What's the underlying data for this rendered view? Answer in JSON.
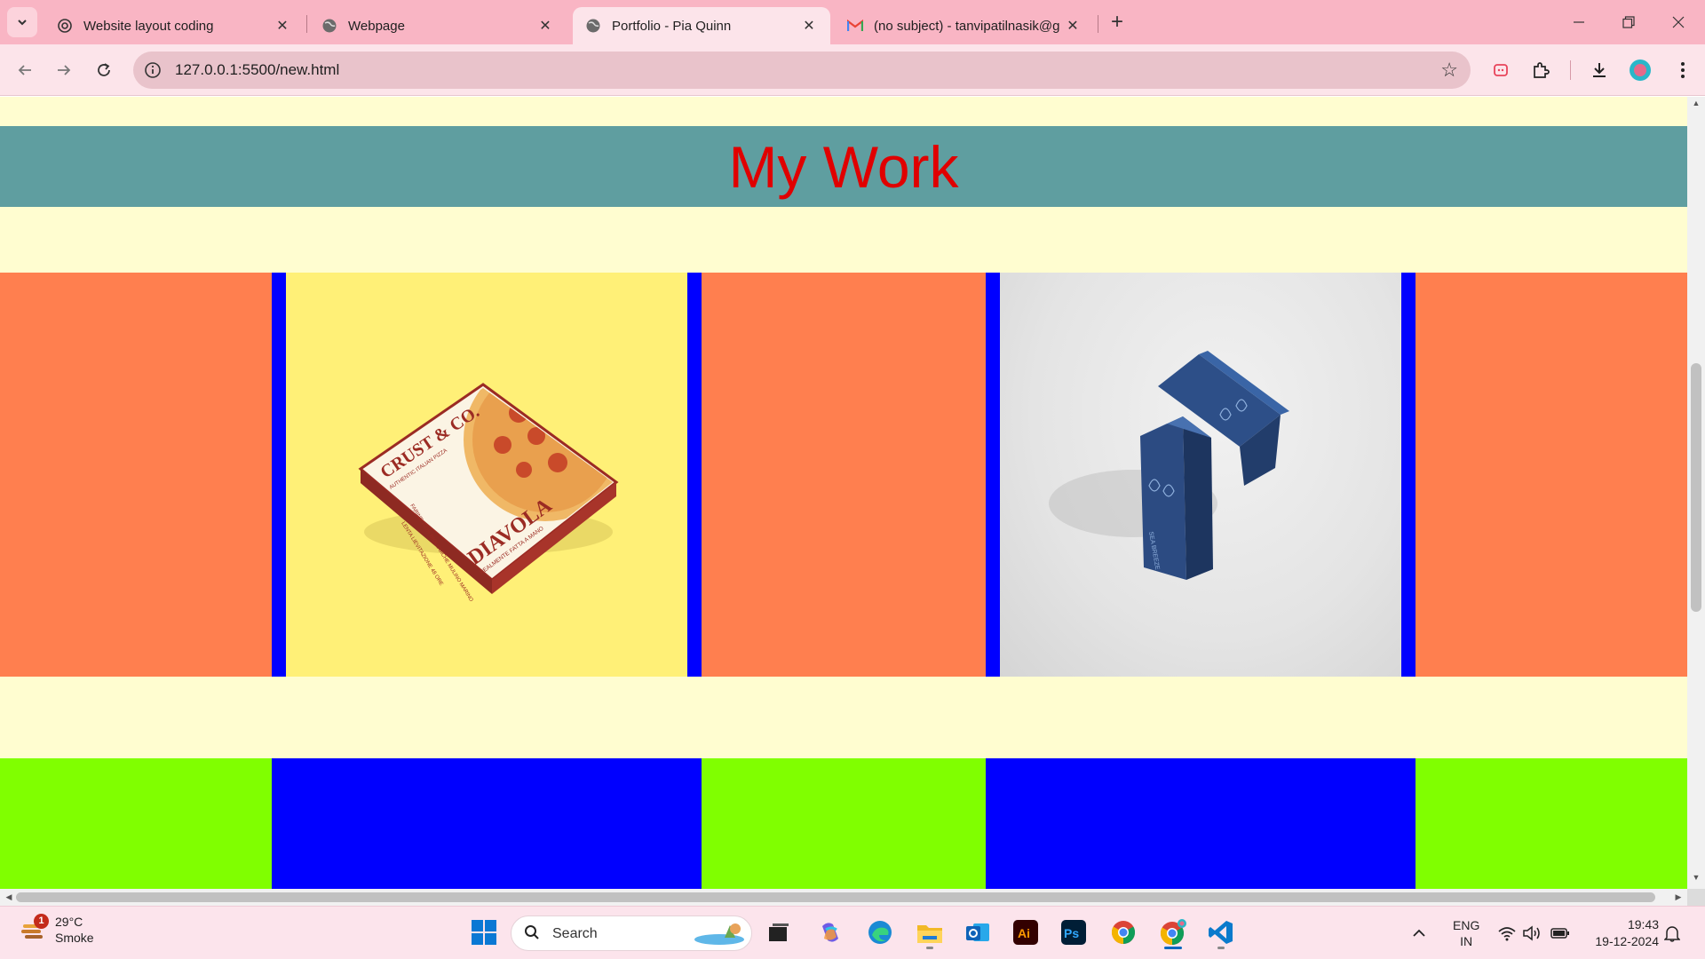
{
  "browser": {
    "tabs": [
      {
        "title": "Website layout coding",
        "active": false,
        "favicon": "openai-icon"
      },
      {
        "title": "Webpage",
        "active": false,
        "favicon": "globe-icon"
      },
      {
        "title": "Portfolio - Pia Quinn",
        "active": true,
        "favicon": "globe-icon"
      },
      {
        "title": "(no subject) - tanvipatilnasik@g",
        "active": false,
        "favicon": "gmail-icon"
      }
    ],
    "address": "127.0.0.1:5500/new.html"
  },
  "page": {
    "heading": "My Work",
    "colors": {
      "background": "#fffdd0",
      "header_band": "#5f9ea0",
      "heading_text": "#e00000",
      "orange": "#ff7f4f",
      "blue": "#0000ff",
      "green": "#80ff00",
      "yellow": "#fff077"
    },
    "gallery": [
      {
        "image": "pizza-box-icon",
        "text": [
          "CRUST & CO.",
          "AUTHENTIC ITALIAN PIZZA",
          "DIAVOLA",
          "REALMENTE FATTA A MANO",
          "FARINE 100% BIOLOGICHE MULINO MARINO",
          "LENTA LIEVITAZIONE 48 ORE"
        ]
      },
      {
        "image": "blue-boxes-icon",
        "text": [
          "SEA BREEZE"
        ]
      }
    ]
  },
  "taskbar": {
    "weather": {
      "temp": "29°C",
      "desc": "Smoke",
      "badge": "1"
    },
    "search_label": "Search",
    "apps": [
      "start-icon",
      "task-view-icon",
      "copilot-icon",
      "edge-icon",
      "file-explorer-icon",
      "outlook-icon",
      "illustrator-icon",
      "photoshop-icon",
      "chrome-icon",
      "chrome-profile-icon",
      "vscode-icon"
    ],
    "lang": [
      "ENG",
      "IN"
    ],
    "time": "19:43",
    "date": "19-12-2024"
  }
}
